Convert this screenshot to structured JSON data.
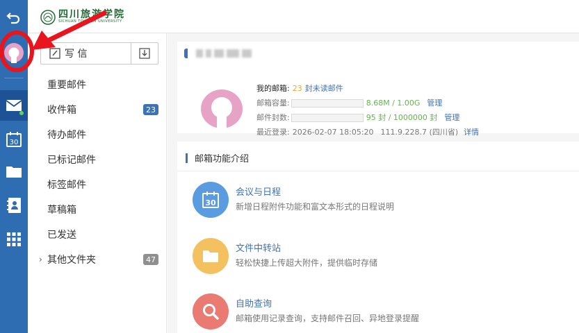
{
  "header": {
    "logo_text": "四川旅游学院",
    "logo_sub": "SICHUAN TOURISM UNIVERSITY"
  },
  "sidebar": {
    "compose_label": "写 信",
    "folders": [
      {
        "label": "重要邮件"
      },
      {
        "label": "收件箱",
        "badge": "23"
      },
      {
        "label": "待办邮件"
      },
      {
        "label": "已标记邮件"
      },
      {
        "label": "标签邮件"
      },
      {
        "label": "草稿箱"
      },
      {
        "label": "已发送"
      },
      {
        "label": "其他文件夹",
        "badge": "47"
      }
    ]
  },
  "account": {
    "my_mailbox_label": "我的邮箱:",
    "unread_count": "23",
    "unread_text": "封未读邮件",
    "capacity_label": "邮箱容量:",
    "capacity_value": "8.68M / 1.00G",
    "count_label": "邮件封数:",
    "count_value": "95 封 / 1000000 封",
    "manage_label": "管理",
    "last_login_label": "最近登录:",
    "last_login_time": "2026-02-07 18:05:20",
    "last_login_ip": "111.9.228.7 (四川省)",
    "details_label": "详情"
  },
  "features": {
    "section_title": "邮箱功能介绍",
    "items": [
      {
        "title": "会议与日程",
        "desc": "新增日程附件功能和富文本形式的日程说明",
        "icon": "calendar-icon",
        "color": "#5b9be0"
      },
      {
        "title": "文件中转站",
        "desc": "轻松快捷上传超大附件，提供临时存储",
        "icon": "folder-icon",
        "color": "#f3c160"
      },
      {
        "title": "自助查询",
        "desc": "邮箱使用记录查询，支持邮件召回、异地登录提醒",
        "icon": "search-icon",
        "color": "#e97b73"
      }
    ]
  },
  "colors": {
    "rail": "#2f6db3",
    "accent": "#3f72b5",
    "annotation": "#e8141e"
  }
}
